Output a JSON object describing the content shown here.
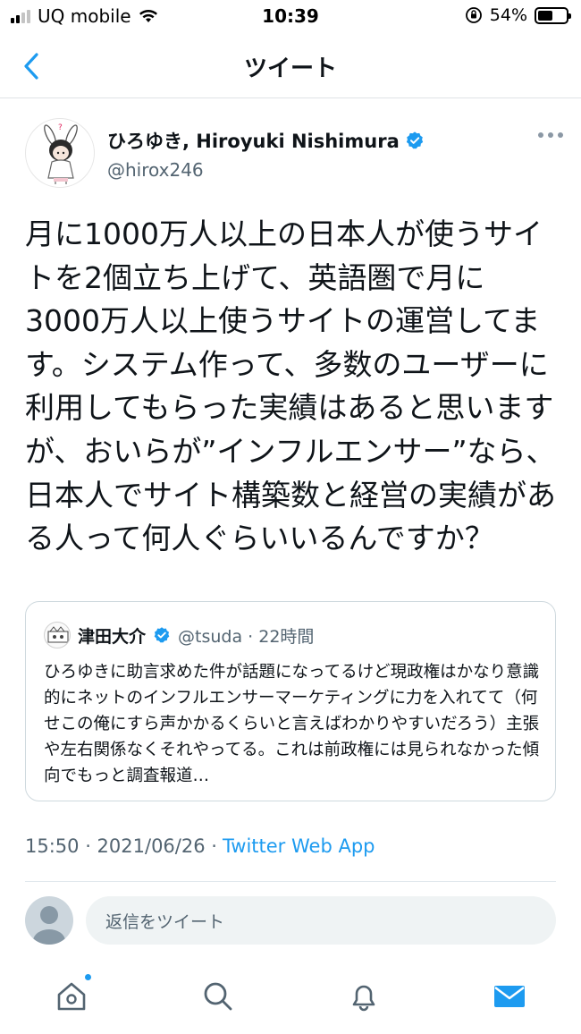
{
  "status_bar": {
    "carrier": "UQ mobile",
    "time": "10:39",
    "battery_percent": "54%",
    "battery_level": 0.54
  },
  "nav": {
    "title": "ツイート",
    "back_icon": "chevron-left-icon"
  },
  "tweet": {
    "display_name": "ひろゆき, Hiroyuki Nishimura",
    "handle": "@hirox246",
    "verified": true,
    "text": "月に1000万人以上の日本人が使うサイトを2個立ち上げて、英語圏で月に3000万人以上使うサイトの運営してます。システム作って、多数のユーザーに利用してもらった実績はあると思いますが、おいらが”インフルエンサー”なら、日本人でサイト構築数と経営の実績がある人って何人ぐらいいるんですか？",
    "timestamp": "15:50 · 2021/06/26 ·",
    "source": "Twitter Web App"
  },
  "quote": {
    "display_name": "津田大介",
    "handle_time": "@tsuda · 22時間",
    "verified": true,
    "text": "ひろゆきに助言求めた件が話題になってるけど現政権はかなり意識的にネットのインフルエンサーマーケティングに力を入れてて（何せこの俺にすら声かかるくらいと言えばわかりやすいだろう）主張や左右関係なくそれやってる。これは前政権には見られなかった傾向でもっと調査報道…"
  },
  "reply": {
    "placeholder": "返信をツイート"
  },
  "tabs": [
    "home-icon",
    "search-icon",
    "notifications-icon",
    "messages-icon"
  ],
  "colors": {
    "accent": "#1d9bf0",
    "text": "#0f1419",
    "secondary": "#536471"
  }
}
